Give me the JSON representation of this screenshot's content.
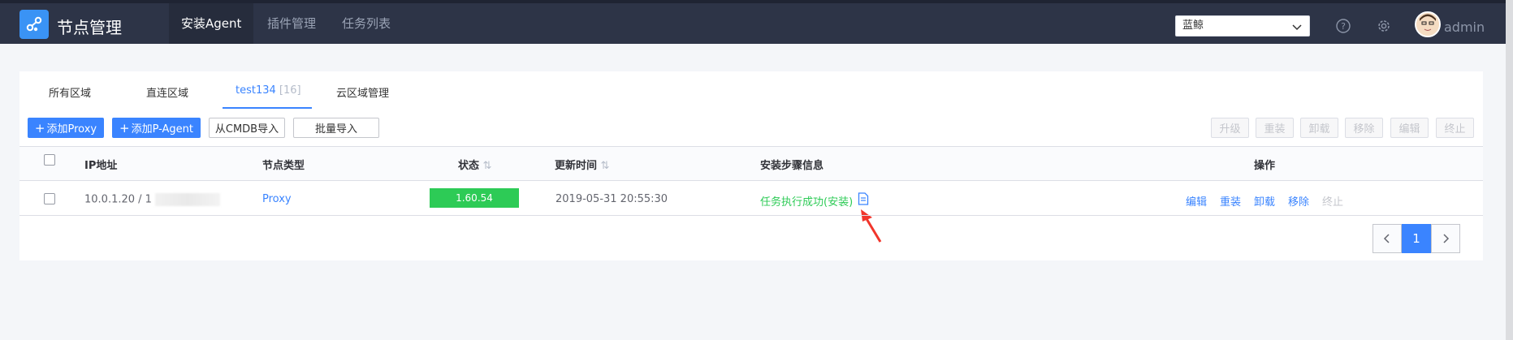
{
  "app": {
    "title": "节点管理"
  },
  "nav": {
    "tabs": [
      "安装Agent",
      "插件管理",
      "任务列表"
    ],
    "active_index": 0
  },
  "header": {
    "business_select": "蓝鲸",
    "user": "admin"
  },
  "subtabs": [
    {
      "label": "所有区域",
      "count": ""
    },
    {
      "label": "直连区域",
      "count": ""
    },
    {
      "label": "test134",
      "count": "[16]"
    },
    {
      "label": "云区域管理",
      "count": ""
    }
  ],
  "actions": {
    "add_proxy": "添加Proxy",
    "add_p_agent": "添加P-Agent",
    "import_cmdb": "从CMDB导入",
    "batch_import": "批量导入",
    "upgrade": "升级",
    "reinstall": "重装",
    "uninstall": "卸载",
    "remove": "移除",
    "edit": "编辑",
    "terminate": "终止"
  },
  "table": {
    "columns": [
      "IP地址",
      "节点类型",
      "状态",
      "更新时间",
      "安装步骤信息",
      "操作"
    ],
    "rows": [
      {
        "ip": "10.0.1.20 / 1",
        "node_type": "Proxy",
        "status": "1.60.54",
        "updated": "2019-05-31 20:55:30",
        "install_info": "任务执行成功(安装)",
        "ops": [
          "编辑",
          "重装",
          "卸载",
          "移除",
          "终止"
        ]
      }
    ]
  },
  "pagination": {
    "current": "1"
  },
  "colors": {
    "topbar": "#2d3447",
    "accent": "#3a84ff",
    "success": "#2dcb56"
  }
}
